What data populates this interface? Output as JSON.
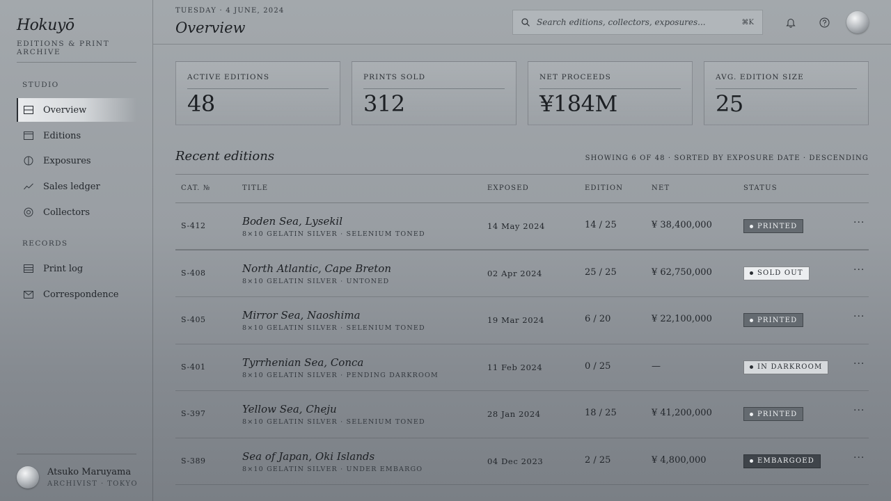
{
  "brand": {
    "name": "Hokuyō",
    "subtitle": "EDITIONS & PRINT ARCHIVE"
  },
  "sidebar": {
    "sections": [
      {
        "label": "STUDIO"
      },
      {
        "label": "RECORDS"
      }
    ],
    "studio_items": [
      {
        "label": "Overview",
        "icon": "layout-icon",
        "active": true
      },
      {
        "label": "Editions",
        "icon": "window-icon"
      },
      {
        "label": "Exposures",
        "icon": "aperture-icon"
      },
      {
        "label": "Sales ledger",
        "icon": "trend-line-icon"
      },
      {
        "label": "Collectors",
        "icon": "target-icon"
      }
    ],
    "records_items": [
      {
        "label": "Print log",
        "icon": "list-icon"
      },
      {
        "label": "Correspondence",
        "icon": "mail-icon"
      }
    ],
    "user": {
      "name": "Atsuko Maruyama",
      "role": "ARCHIVIST · TOKYO"
    }
  },
  "header": {
    "date": "TUESDAY · 4 JUNE, 2024",
    "title": "Overview",
    "search_placeholder": "Search editions, collectors, exposures...",
    "search_shortcut": "⌘K"
  },
  "stats": [
    {
      "label": "ACTIVE EDITIONS",
      "value": "48"
    },
    {
      "label": "PRINTS SOLD",
      "value": "312"
    },
    {
      "label": "NET PROCEEDS",
      "value": "¥184M"
    },
    {
      "label": "AVG. EDITION SIZE",
      "value": "25"
    }
  ],
  "recent": {
    "title": "Recent editions",
    "meta": "SHOWING 6 OF 48 · SORTED BY EXPOSURE DATE · DESCENDING",
    "columns": [
      "CAT. №",
      "TITLE",
      "EXPOSED",
      "EDITION",
      "NET",
      "STATUS"
    ],
    "rows": [
      {
        "cat": "S-412",
        "title": "Boden Sea, Lysekil",
        "sub": "8×10 GELATIN SILVER · SELENIUM TONED",
        "exposed": "14 May 2024",
        "edition": "14 / 25",
        "net": "¥ 38,400,000",
        "status": "PRINTED",
        "status_kind": "printed"
      },
      {
        "cat": "S-408",
        "title": "North Atlantic, Cape Breton",
        "sub": "8×10 GELATIN SILVER · UNTONED",
        "exposed": "02 Apr 2024",
        "edition": "25 / 25",
        "net": "¥ 62,750,000",
        "status": "SOLD OUT",
        "status_kind": "sold"
      },
      {
        "cat": "S-405",
        "title": "Mirror Sea, Naoshima",
        "sub": "8×10 GELATIN SILVER · SELENIUM TONED",
        "exposed": "19 Mar 2024",
        "edition": "6 / 20",
        "net": "¥ 22,100,000",
        "status": "PRINTED",
        "status_kind": "printed"
      },
      {
        "cat": "S-401",
        "title": "Tyrrhenian Sea, Conca",
        "sub": "8×10 GELATIN SILVER · PENDING DARKROOM",
        "exposed": "11 Feb 2024",
        "edition": "0 / 25",
        "net": "—",
        "status": "IN DARKROOM",
        "status_kind": "dark"
      },
      {
        "cat": "S-397",
        "title": "Yellow Sea, Cheju",
        "sub": "8×10 GELATIN SILVER · SELENIUM TONED",
        "exposed": "28 Jan 2024",
        "edition": "18 / 25",
        "net": "¥ 41,200,000",
        "status": "PRINTED",
        "status_kind": "printed"
      },
      {
        "cat": "S-389",
        "title": "Sea of Japan, Oki Islands",
        "sub": "8×10 GELATIN SILVER · UNDER EMBARGO",
        "exposed": "04 Dec 2023",
        "edition": "2 / 25",
        "net": "¥ 4,800,000",
        "status": "EMBARGOED",
        "status_kind": "embargo"
      }
    ],
    "row_action": "···"
  }
}
